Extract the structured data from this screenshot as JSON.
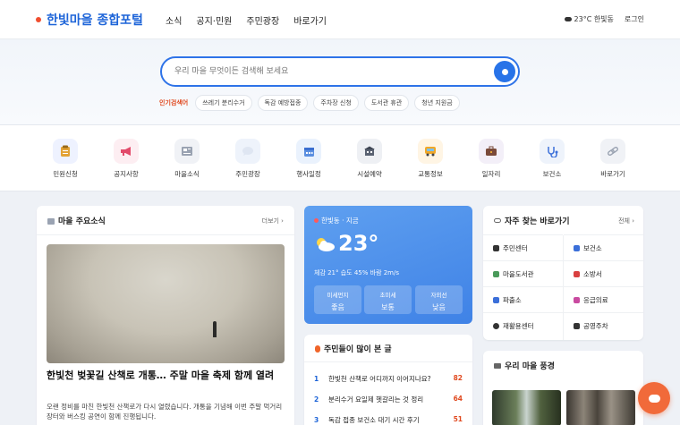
{
  "header": {
    "logo": "한빛마을 종합포털",
    "nav": [
      "소식",
      "공지·민원",
      "주민광장",
      "바로가기"
    ],
    "weather": "23°C 한빛동",
    "login": "로그인"
  },
  "search": {
    "placeholder": "우리 마을 무엇이든 검색해 보세요",
    "popular_label": "인기검색어",
    "popular_tags": [
      "쓰레기 분리수거",
      "독감 예방접종",
      "주차장 신청",
      "도서관 휴관",
      "청년 지원금"
    ]
  },
  "quick_menu": [
    {
      "label": "민원신청",
      "icon": "clipboard-icon",
      "bg": "#eef2ff"
    },
    {
      "label": "공지사항",
      "icon": "megaphone-icon",
      "bg": "#fdeef2"
    },
    {
      "label": "마을소식",
      "icon": "newspaper-icon",
      "bg": "#f0f2f6"
    },
    {
      "label": "주민광장",
      "icon": "chat-bubble-icon",
      "bg": "#eef3fb"
    },
    {
      "label": "행사일정",
      "icon": "calendar-icon",
      "bg": "#eaf2fd"
    },
    {
      "label": "시설예약",
      "icon": "building-icon",
      "bg": "#eef0f4"
    },
    {
      "label": "교통정보",
      "icon": "bus-icon",
      "bg": "#fff5e4"
    },
    {
      "label": "일자리",
      "icon": "briefcase-icon",
      "bg": "#f3eff8"
    },
    {
      "label": "보건소",
      "icon": "stethoscope-icon",
      "bg": "#eef3fb"
    },
    {
      "label": "바로가기",
      "icon": "link-icon",
      "bg": "#f0f2f6"
    }
  ],
  "news": {
    "title": "마을 주요소식",
    "more": "더보기 ›",
    "headline": "한빛천 벚꽃길 산책로 개통… 주말 마을 축제 함께 열려",
    "body": "오랜 정비를 마친 한빛천 산책로가 다시 열렸습니다. 개통을 기념해 이번 주말 먹거리 장터와 버스킹 공연이 함께 진행됩니다."
  },
  "weather": {
    "location": "한빛동 · 지금",
    "temp": "23°",
    "detail": "체감 21°   습도 45%   바람 2m/s",
    "boxes": [
      {
        "label": "미세먼지",
        "value": "좋음"
      },
      {
        "label": "초미세",
        "value": "보통"
      },
      {
        "label": "자외선",
        "value": "낮음"
      }
    ]
  },
  "popular": {
    "title": "주민들이 많이 본 글",
    "items": [
      {
        "rank": "1",
        "text": "한빛천 산책로 어디까지 이어지나요?",
        "count": "82"
      },
      {
        "rank": "2",
        "text": "분리수거 요일제 헷갈리는 것 정리",
        "count": "64"
      },
      {
        "rank": "3",
        "text": "독감 접종 보건소 대기 시간 후기",
        "count": "51"
      }
    ]
  },
  "shortcuts": {
    "title": "자주 찾는 바로가기",
    "more": "전체 ›",
    "items": [
      {
        "label": "주민센터",
        "icon": "house-icon",
        "color": "#333"
      },
      {
        "label": "보건소",
        "icon": "stethoscope-icon",
        "color": "#3b6fd9"
      },
      {
        "label": "마을도서관",
        "icon": "books-icon",
        "color": "#4a9a5a"
      },
      {
        "label": "소방서",
        "icon": "fire-truck-icon",
        "color": "#d94040"
      },
      {
        "label": "파출소",
        "icon": "police-icon",
        "color": "#3b6fd9"
      },
      {
        "label": "응급의료",
        "icon": "hospital-icon",
        "color": "#c94aa0"
      },
      {
        "label": "재활용센터",
        "icon": "recycle-icon",
        "color": "#333"
      },
      {
        "label": "공영주차",
        "icon": "parking-icon",
        "color": "#333"
      }
    ]
  },
  "scenery": {
    "title": "우리 마을 풍경"
  }
}
